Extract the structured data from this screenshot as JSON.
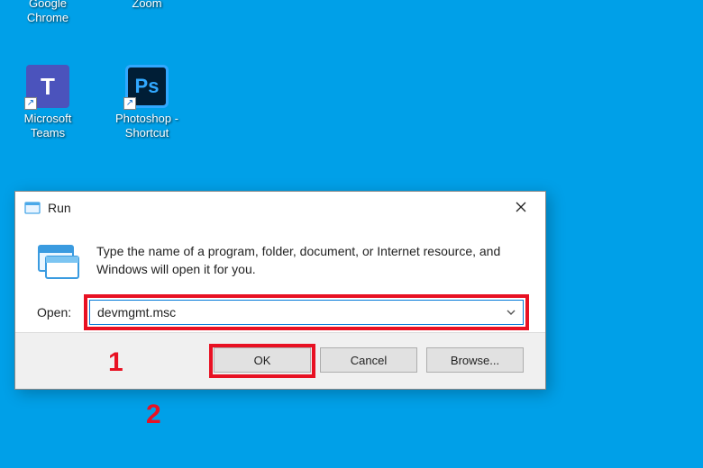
{
  "desktop": {
    "icons": [
      {
        "label": "Google\nChrome"
      },
      {
        "label": "Zoom"
      },
      {
        "label": "Microsoft\nTeams"
      },
      {
        "label": "Photoshop -\nShortcut"
      }
    ]
  },
  "run_dialog": {
    "title": "Run",
    "instruction": "Type the name of a program, folder, document, or Internet resource, and Windows will open it for you.",
    "open_label": "Open:",
    "input_value": "devmgmt.msc",
    "buttons": {
      "ok": "OK",
      "cancel": "Cancel",
      "browse": "Browse..."
    }
  },
  "annotations": {
    "step1": "1",
    "step2": "2"
  },
  "colors": {
    "desktop_bg": "#00a0e8",
    "highlight": "#e81123",
    "accent": "#0078d7"
  }
}
